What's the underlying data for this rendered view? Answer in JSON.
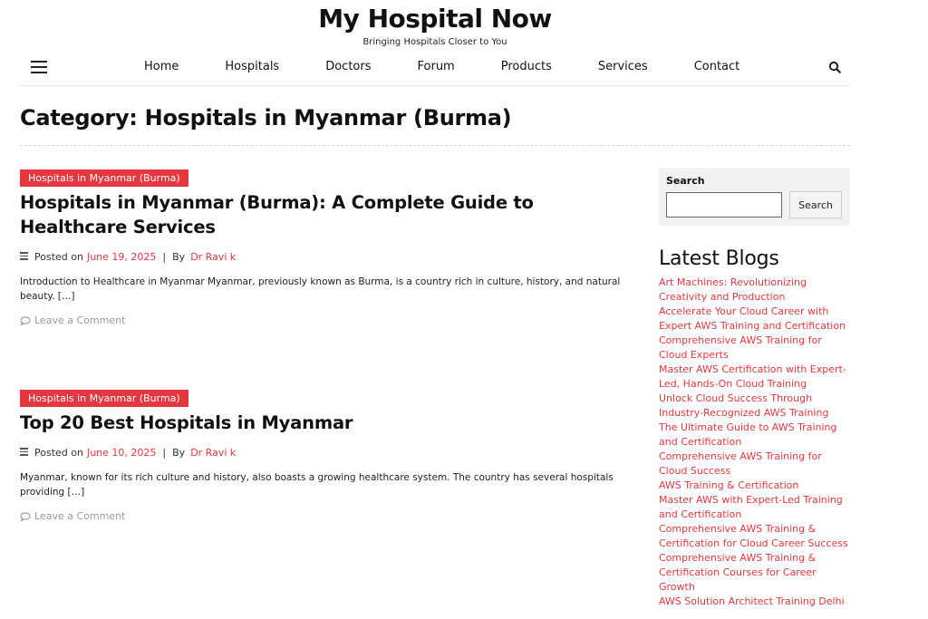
{
  "site": {
    "title": "My Hospital Now",
    "tagline": "Bringing Hospitals Closer to You"
  },
  "nav": {
    "items": [
      "Home",
      "Hospitals",
      "Doctors",
      "Forum",
      "Products",
      "Services",
      "Contact"
    ]
  },
  "page": {
    "title": "Category: Hospitals in Myanmar (Burma)"
  },
  "posts": [
    {
      "category": "Hospitals in Myanmar (Burma)",
      "title": "Hospitals in Myanmar (Burma): A Complete Guide to Healthcare Services",
      "posted_label": "Posted on",
      "date": "June 19, 2025",
      "by_label": "By",
      "author": "Dr Ravi k",
      "excerpt": "Introduction to Healthcare in Myanmar Myanmar, previously known as Burma, is a country rich in culture, history, and natural beauty. […]",
      "comment_label": "Leave a Comment"
    },
    {
      "category": "Hospitals in Myanmar (Burma)",
      "title": "Top 20 Best Hospitals in Myanmar",
      "posted_label": "Posted on",
      "date": "June 10, 2025",
      "by_label": "By",
      "author": "Dr Ravi k",
      "excerpt": "Myanmar, known for its rich culture and history, also boasts a growing healthcare system. The country has several hospitals providing […]",
      "comment_label": "Leave a Comment"
    }
  ],
  "sidebar": {
    "search_label": "Search",
    "search_button": "Search",
    "search_placeholder": "",
    "latest_heading": "Latest Blogs",
    "blogs": [
      "Art Machines: Revolutionizing Creativity and Production",
      "Accelerate Your Cloud Career with Expert AWS Training and Certification",
      "Comprehensive AWS Training for Cloud Experts",
      "Master AWS Certification with Expert-Led, Hands-On Cloud Training",
      "Unlock Cloud Success Through Industry-Recognized AWS Training",
      "The Ultimate Guide to AWS Training and Certification",
      "Comprehensive AWS Training for Cloud Success",
      "AWS Training & Certification",
      "Master AWS with Expert-Led Training and Certification",
      "Comprehensive AWS Training & Certification for Cloud Career Success",
      "Comprehensive AWS Training & Certification Courses for Career Growth",
      "AWS Solution Architect Training Delhi"
    ]
  },
  "colors": {
    "accent": "#e4373f",
    "text": "#111111",
    "muted": "#999999"
  },
  "icons": {
    "menu": "hamburger-icon",
    "search": "search-icon",
    "meta": "list-icon",
    "comment": "comment-icon"
  }
}
